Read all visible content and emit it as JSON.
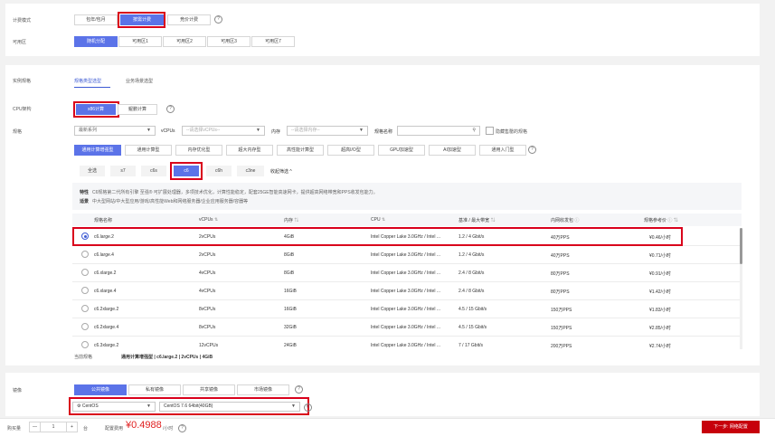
{
  "billing": {
    "label": "计费模式",
    "options": [
      "包年/包月",
      "按需计费",
      "竞价计费"
    ],
    "selected": 1,
    "help": "?"
  },
  "zone": {
    "label": "可用区",
    "options": [
      "随机分配",
      "可用区1",
      "可用区2",
      "可用区3",
      "可用区7"
    ],
    "selected": 0,
    "help": "?"
  },
  "instance": {
    "label": "实例规格",
    "tabs": [
      "规格类型选型",
      "业务场景选型"
    ],
    "active_tab": 0,
    "cpu_arch": {
      "label": "CPU架构",
      "options": [
        "x86计算",
        "鲲鹏计算"
      ],
      "selected": 0,
      "help": "?"
    },
    "filters": {
      "label": "规格",
      "series_value": "最新系列",
      "vcpus_label": "vCPUs",
      "vcpus_placeholder": "--请选择vCPUs--",
      "mem_label": "内存",
      "mem_placeholder": "--请选择内存--",
      "name_label": "规格名称",
      "hide_label": "隐藏售罄的规格",
      "search_icon": "search-icon"
    },
    "categories": [
      "通用计算增强型",
      "通用计算型",
      "内存优化型",
      "超大内存型",
      "高性能计算型",
      "超高I/O型",
      "GPU加速型",
      "AI加速型",
      "通用入门型"
    ],
    "category_selected": 0,
    "subfamilies": [
      "全选",
      "s7",
      "c6s",
      "c6",
      "c6h",
      "c3ne"
    ],
    "subfamily_selected": 3,
    "collapse_label": "收起筛选 ^",
    "desc_feature_label": "特性",
    "desc_feature": "C6规格第二代所有引擎 至强® 可扩展处理器，多项技术优化，计算性能稳定，配套25GE智能高速网卡，提供超高网络带宽和PPS收发包能力。",
    "desc_scene_label": "适景",
    "desc_scene": "中大型网站/中大型应用/游戏/高性能Web和网络服务器/企业应用服务器/容器等",
    "columns": [
      "规格名称",
      "vCPUs",
      "内存",
      "CPU",
      "基准 / 最大带宽",
      "内网收发包",
      "规格参考价"
    ],
    "rows": [
      {
        "name": "c6.large.2",
        "vcpus": "2vCPUs",
        "mem": "4GiB",
        "cpu": "Intel Copper Lake 3.0GHz / Intel ...",
        "bw": "1.2 / 4 Gbit/s",
        "pps": "40万PPS",
        "price": "¥0.46/小时",
        "selected": true
      },
      {
        "name": "c6.large.4",
        "vcpus": "2vCPUs",
        "mem": "8GiB",
        "cpu": "Intel Copper Lake 3.0GHz / Intel ...",
        "bw": "1.2 / 4 Gbit/s",
        "pps": "40万PPS",
        "price": "¥0.71/小时",
        "selected": false
      },
      {
        "name": "c6.xlarge.2",
        "vcpus": "4vCPUs",
        "mem": "8GiB",
        "cpu": "Intel Copper Lake 3.0GHz / Intel ...",
        "bw": "2.4 / 8 Gbit/s",
        "pps": "80万PPS",
        "price": "¥0.91/小时",
        "selected": false
      },
      {
        "name": "c6.xlarge.4",
        "vcpus": "4vCPUs",
        "mem": "16GiB",
        "cpu": "Intel Copper Lake 3.0GHz / Intel ...",
        "bw": "2.4 / 8 Gbit/s",
        "pps": "80万PPS",
        "price": "¥1.42/小时",
        "selected": false
      },
      {
        "name": "c6.2xlarge.2",
        "vcpus": "8vCPUs",
        "mem": "16GiB",
        "cpu": "Intel Copper Lake 3.0GHz / Intel ...",
        "bw": "4.5 / 15 Gbit/s",
        "pps": "150万PPS",
        "price": "¥1.83/小时",
        "selected": false
      },
      {
        "name": "c6.2xlarge.4",
        "vcpus": "8vCPUs",
        "mem": "32GiB",
        "cpu": "Intel Copper Lake 3.0GHz / Intel ...",
        "bw": "4.5 / 15 Gbit/s",
        "pps": "150万PPS",
        "price": "¥2.85/小时",
        "selected": false
      },
      {
        "name": "c6.3xlarge.2",
        "vcpus": "12vCPUs",
        "mem": "24GiB",
        "cpu": "Intel Copper Lake 3.0GHz / Intel ...",
        "bw": "7 / 17 Gbit/s",
        "pps": "200万PPS",
        "price": "¥2.74/小时",
        "selected": false
      }
    ],
    "current_label": "当前规格",
    "current_value": "通用计算增强型 | c6.large.2 | 2vCPUs | 4GiB"
  },
  "image": {
    "label": "镜像",
    "tabs": [
      "公共镜像",
      "私有镜像",
      "共享镜像",
      "市场镜像"
    ],
    "selected": 0,
    "help": "?",
    "os_value": "CentOS",
    "version_value": "CentOS 7.6 64bit(40GB)"
  },
  "footer": {
    "qty_label": "购买量",
    "qty_minus": "—",
    "qty_value": "1",
    "qty_plus": "+",
    "qty_unit": "台",
    "fee_label": "配置费用",
    "fee_value": "¥0.4988",
    "fee_unit": "/小时",
    "help": "?",
    "next_label": "下一步: 网络配置"
  },
  "colors": {
    "accent": "#5b73e8",
    "highlight": "#d9001b",
    "price": "#e02020",
    "next_button": "#c7000b"
  }
}
